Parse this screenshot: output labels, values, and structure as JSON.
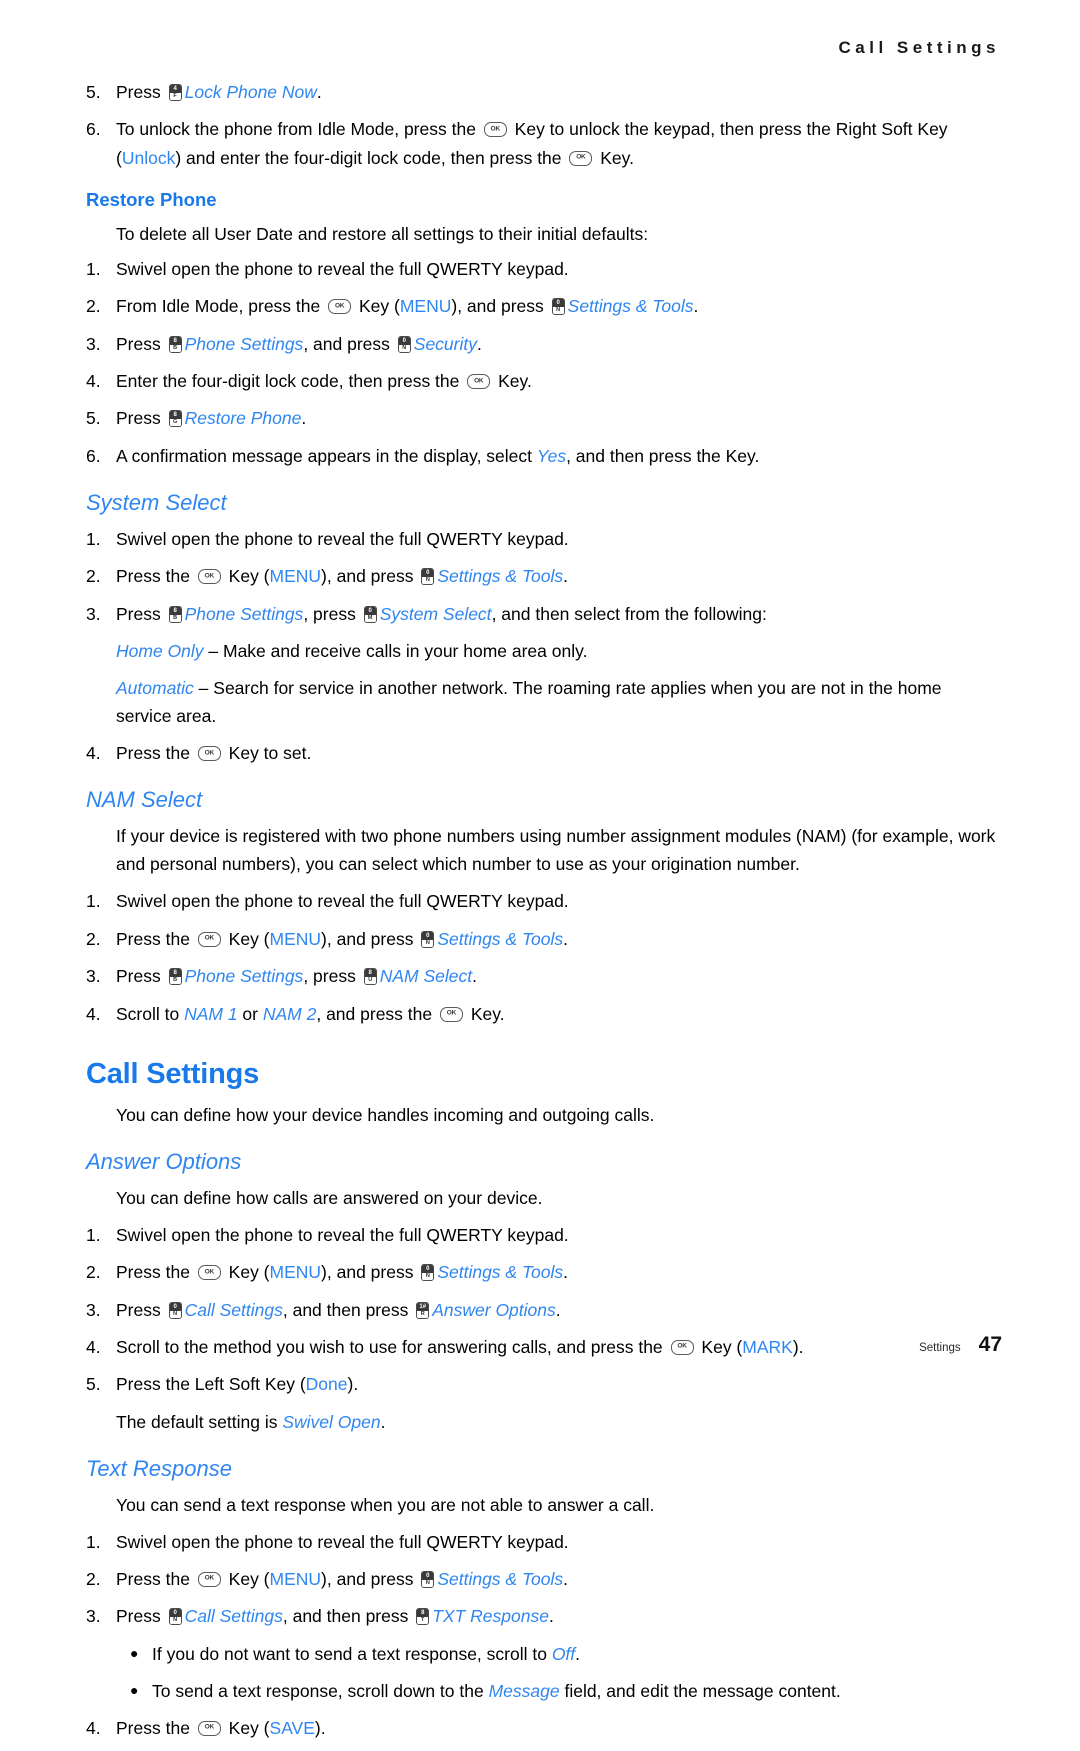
{
  "header": {
    "running_title": "Call Settings"
  },
  "footer": {
    "section_label": "Settings",
    "page_number": "47"
  },
  "colors": {
    "accent_blue": "#2f86f0",
    "heading_blue": "#1879ea",
    "text_black": "#000000"
  },
  "keys": {
    "ok_label": "OK",
    "lock_phone_now": {
      "top": "4",
      "bottom": "F"
    },
    "settings_tools": {
      "top": "0",
      "bottom": "N"
    },
    "phone_settings": {
      "top": "8",
      "bottom": "B"
    },
    "security": {
      "top": "0",
      "bottom": "N"
    },
    "restore_phone": {
      "top": "8",
      "bottom": "G"
    },
    "system_select": {
      "top": "0",
      "bottom": "M"
    },
    "nam_select": {
      "top": "8",
      "bottom": "U"
    },
    "call_settings": {
      "top": "0",
      "bottom": "N"
    },
    "answer_options": {
      "top": "1#",
      "bottom": "R"
    },
    "txt_response": {
      "top": "8",
      "bottom": "T"
    }
  },
  "lock_steps": {
    "step5": {
      "num": "5.",
      "pre": "Press ",
      "link": "Lock Phone Now",
      "post": "."
    },
    "step6": {
      "num": "6.",
      "a": "To unlock the phone from Idle Mode, press the ",
      "b": " Key to unlock the keypad, then press the Right Soft Key (",
      "unlock": "Unlock",
      "c": ") and enter the four-digit lock code, then press the ",
      "d": " Key."
    }
  },
  "restore_phone": {
    "heading": "Restore Phone",
    "intro": "To delete all User Date and restore all settings to their initial defaults:",
    "steps": [
      {
        "num": "1.",
        "a": "Swivel open the phone to reveal the full QWERTY keypad."
      },
      {
        "num": "2.",
        "a": "From Idle Mode, press the ",
        "b": " Key (",
        "menu": "MENU",
        "c": "), and press ",
        "link": "Settings & Tools",
        "d": "."
      },
      {
        "num": "3.",
        "a": "Press ",
        "link1": "Phone Settings",
        "b": ", and press ",
        "link2": "Security",
        "c": "."
      },
      {
        "num": "4.",
        "a": "Enter the four-digit lock code, then press the ",
        "b": " Key."
      },
      {
        "num": "5.",
        "a": "Press ",
        "link1": "Restore Phone",
        "b": "."
      },
      {
        "num": "6.",
        "a": "A confirmation message appears in the display, select ",
        "yes": "Yes",
        "b": ", and then press the Key."
      }
    ]
  },
  "system_select": {
    "heading": "System Select",
    "steps": [
      {
        "num": "1.",
        "a": "Swivel open the phone to reveal the full QWERTY keypad."
      },
      {
        "num": "2.",
        "a": "Press the ",
        "b": " Key (",
        "menu": "MENU",
        "c": "), and press ",
        "link": "Settings & Tools",
        "d": "."
      },
      {
        "num": "3.",
        "a": "Press ",
        "link1": "Phone Settings",
        "b": ", press ",
        "link2": "System Select",
        "c": ", and then select from the following:"
      }
    ],
    "options": [
      {
        "name": "Home Only",
        "desc": " – Make and receive calls in your home area only."
      },
      {
        "name": "Automatic",
        "desc": " – Search for service in another network. The roaming rate applies when you are not in the home service area."
      }
    ],
    "final_step": {
      "num": "4.",
      "a": "Press the ",
      "b": " Key to set."
    }
  },
  "nam_select": {
    "heading": "NAM Select",
    "intro": "If your device is registered with two phone numbers using number assignment modules (NAM) (for example, work and personal numbers), you can select which number to use as your origination number.",
    "steps": [
      {
        "num": "1.",
        "a": "Swivel open the phone to reveal the full QWERTY keypad."
      },
      {
        "num": "2.",
        "a": "Press the ",
        "b": " Key (",
        "menu": "MENU",
        "c": "), and press ",
        "link": "Settings & Tools",
        "d": "."
      },
      {
        "num": "3.",
        "a": "Press ",
        "link1": "Phone Settings",
        "b": ", press ",
        "link2": "NAM Select",
        "c": "."
      },
      {
        "num": "4.",
        "a": "Scroll to ",
        "nam1": "NAM 1",
        "b": " or ",
        "nam2": "NAM 2",
        "c": ", and press the ",
        "d": " Key."
      }
    ]
  },
  "call_settings": {
    "heading": "Call Settings",
    "intro": "You can define how your device handles incoming and outgoing calls."
  },
  "answer_options": {
    "heading": "Answer Options",
    "intro": "You can define how calls are answered on your device.",
    "steps": [
      {
        "num": "1.",
        "a": "Swivel open the phone to reveal the full QWERTY keypad."
      },
      {
        "num": "2.",
        "a": "Press the ",
        "b": " Key (",
        "menu": "MENU",
        "c": "), and press ",
        "link": "Settings & Tools",
        "d": "."
      },
      {
        "num": "3.",
        "a": "Press ",
        "link1": "Call Settings",
        "b": ", and then press ",
        "link2": "Answer Options",
        "c": "."
      },
      {
        "num": "4.",
        "a": "Scroll to the method you wish to use for answering calls, and press the ",
        "b": " Key (",
        "mark": "MARK",
        "c": ")."
      },
      {
        "num": "5.",
        "a": "Press the Left Soft Key (",
        "done": "Done",
        "b": ")."
      }
    ],
    "default_note": {
      "a": "The default setting is ",
      "value": "Swivel Open",
      "b": "."
    }
  },
  "text_response": {
    "heading": "Text Response",
    "intro": "You can send a text response when you are not able to answer a call.",
    "steps": [
      {
        "num": "1.",
        "a": "Swivel open the phone to reveal the full QWERTY keypad."
      },
      {
        "num": "2.",
        "a": "Press the ",
        "b": " Key (",
        "menu": "MENU",
        "c": "), and press ",
        "link": "Settings & Tools",
        "d": "."
      },
      {
        "num": "3.",
        "a": "Press ",
        "link1": "Call Settings",
        "b": ", and then press ",
        "link2": "TXT Response",
        "c": "."
      }
    ],
    "bullets": [
      {
        "a": "If you do not want to send a text response, scroll to ",
        "value": "Off",
        "b": "."
      },
      {
        "a": "To send a text response, scroll down to the ",
        "value": "Message",
        "b": " field, and edit the message content."
      }
    ],
    "final_step": {
      "num": "4.",
      "a": "Press the ",
      "b": " Key (",
      "save": "SAVE",
      "c": ")."
    }
  }
}
